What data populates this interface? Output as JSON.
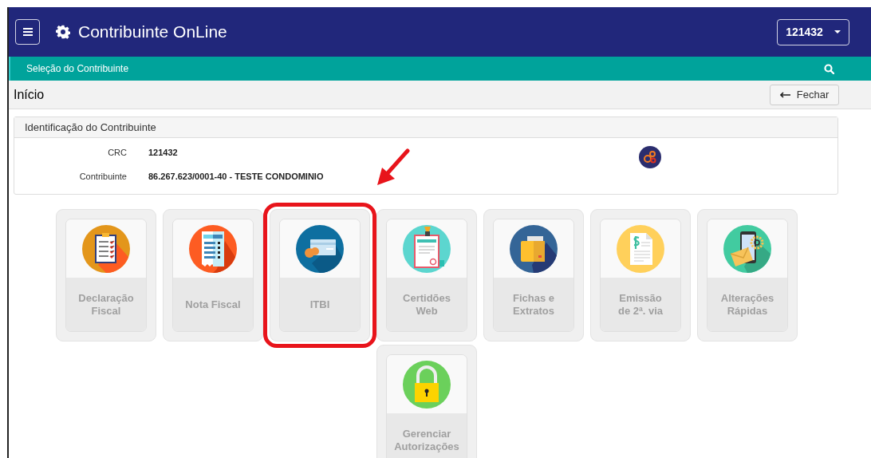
{
  "header": {
    "title": "Contribuinte OnLine",
    "account": "121432"
  },
  "subbar": {
    "label": "Seleção do Contribuinte"
  },
  "page": {
    "title": "Início",
    "close_button": "Fechar"
  },
  "identification": {
    "title": "Identificação do Contribuinte",
    "fields": [
      {
        "label": "CRC",
        "value": "121432"
      },
      {
        "label": "Contribuinte",
        "value": "86.267.623/0001-40 - TESTE CONDOMINIO"
      }
    ]
  },
  "modules": [
    {
      "label": "Declaração Fiscal",
      "kind": "checklist",
      "highlighted": false
    },
    {
      "label": "Nota Fiscal",
      "kind": "receipt",
      "highlighted": false
    },
    {
      "label": "ITBI",
      "kind": "card",
      "highlighted": true
    },
    {
      "label": "Certidões Web",
      "kind": "certificate",
      "highlighted": false
    },
    {
      "label": "Fichas e Extratos",
      "kind": "folder",
      "highlighted": false
    },
    {
      "label": "Emissão de 2ª. via",
      "kind": "document",
      "highlighted": false
    },
    {
      "label": "Alterações Rápidas",
      "kind": "phone",
      "highlighted": false
    },
    {
      "label": "Gerenciar Autorizações",
      "kind": "lock",
      "highlighted": false
    }
  ]
}
